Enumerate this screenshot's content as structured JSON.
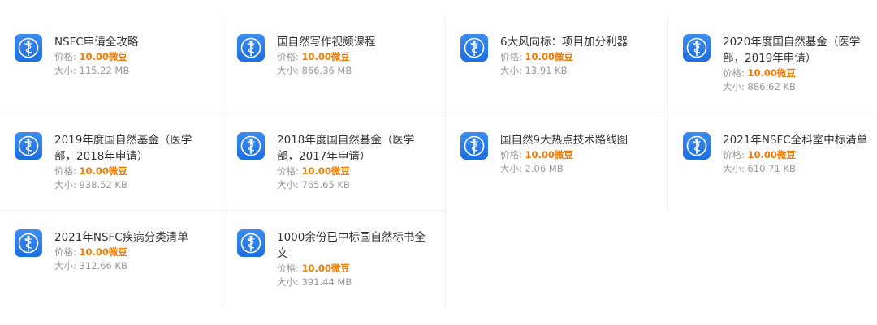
{
  "product_icon": "blue-app-icon-caduceus",
  "colors": {
    "price": "#f27b00",
    "icon_blue": "#1e6fe0",
    "text": "#333333",
    "muted": "#999999"
  },
  "products": [
    {
      "title": "NSFC申请全攻略",
      "price_label": "价格:",
      "price": "10.00微豆",
      "size_label": "大小:",
      "size": "115.22 MB"
    },
    {
      "title": "国自然写作视频课程",
      "price_label": "价格:",
      "price": "10.00微豆",
      "size_label": "大小:",
      "size": "866.36 MB"
    },
    {
      "title": "6大风向标：项目加分利器",
      "price_label": "价格:",
      "price": "10.00微豆",
      "size_label": "大小:",
      "size": "13.91 KB"
    },
    {
      "title": "2020年度国自然基金（医学部，2019年申请）",
      "price_label": "价格:",
      "price": "10.00微豆",
      "size_label": "大小:",
      "size": "886.62 KB"
    },
    {
      "title": "2019年度国自然基金（医学部，2018年申请）",
      "price_label": "价格:",
      "price": "10.00微豆",
      "size_label": "大小:",
      "size": "938.52 KB"
    },
    {
      "title": "2018年度国自然基金（医学部，2017年申请）",
      "price_label": "价格:",
      "price": "10.00微豆",
      "size_label": "大小:",
      "size": "765.65 KB"
    },
    {
      "title": "国自然9大热点技术路线图",
      "price_label": "价格:",
      "price": "10.00微豆",
      "size_label": "大小:",
      "size": "2.06 MB"
    },
    {
      "title": "2021年NSFC全科室中标清单",
      "price_label": "价格:",
      "price": "10.00微豆",
      "size_label": "大小:",
      "size": "610.71 KB"
    },
    {
      "title": "2021年NSFC疾病分类清单",
      "price_label": "价格:",
      "price": "10.00微豆",
      "size_label": "大小:",
      "size": "312.66 KB"
    },
    {
      "title": "1000余份已中标国自然标书全文",
      "price_label": "价格:",
      "price": "10.00微豆",
      "size_label": "大小:",
      "size": "391.44 MB"
    }
  ]
}
